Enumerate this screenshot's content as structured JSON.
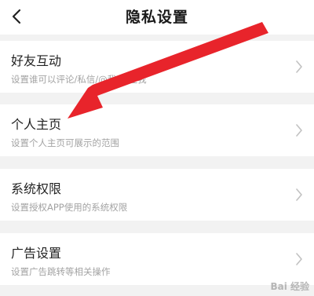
{
  "header": {
    "title": "隐私设置",
    "back_icon": "chevron-left-icon"
  },
  "settings": [
    {
      "title": "好友互动",
      "subtitle": "设置谁可以评论/私信/@我/关注我"
    },
    {
      "title": "个人主页",
      "subtitle": "设置个人主页可展示的范围"
    },
    {
      "title": "系统权限",
      "subtitle": "设置授权APP使用的系统权限"
    },
    {
      "title": "广告设置",
      "subtitle": "设置广告跳转等相关操作"
    }
  ],
  "annotation": {
    "arrow_color": "#e8242b",
    "target": "个人主页"
  },
  "watermark": "Bai 经验",
  "colors": {
    "background": "#f2f2f2",
    "card": "#ffffff",
    "title": "#222222",
    "subtitle": "#a3a3a3",
    "chevron": "#c2c2c2"
  }
}
